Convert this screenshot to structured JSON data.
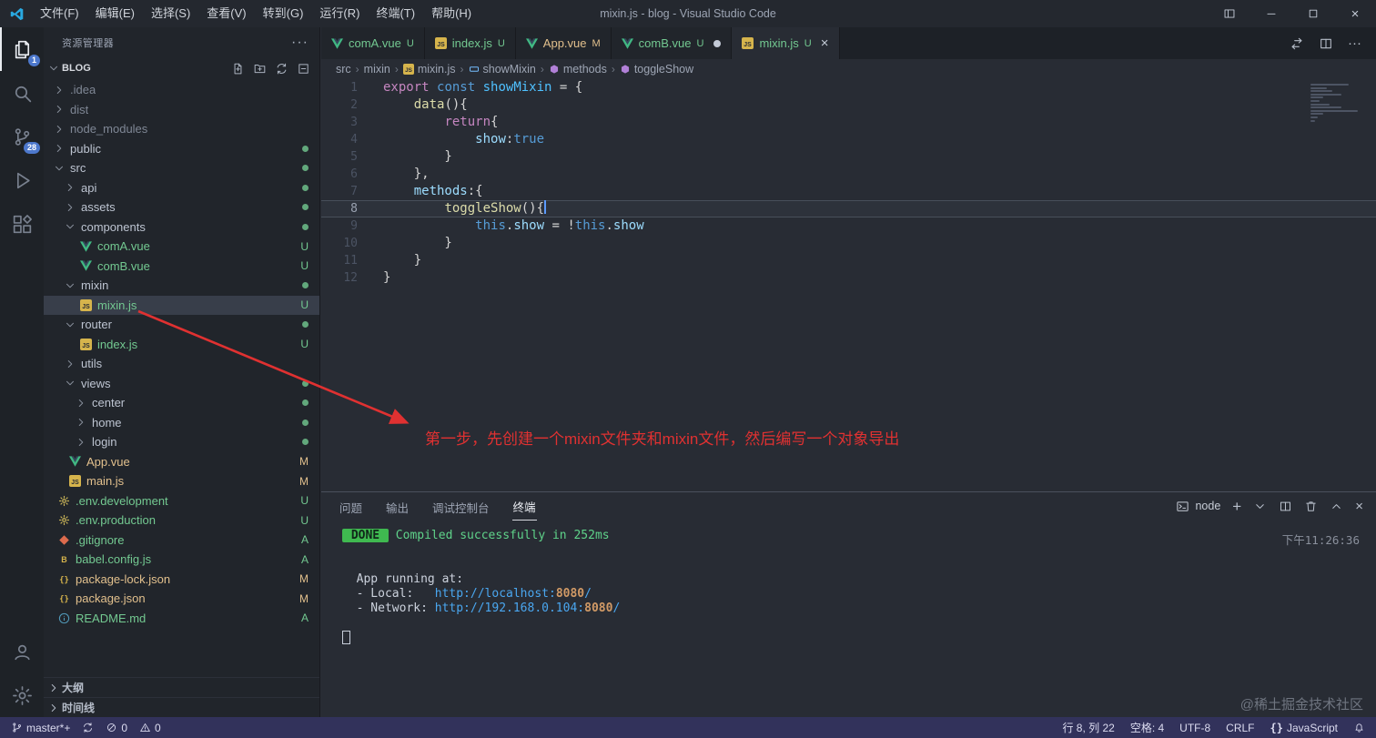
{
  "titlebar": {
    "menus": [
      "文件(F)",
      "编辑(E)",
      "选择(S)",
      "查看(V)",
      "转到(G)",
      "运行(R)",
      "终端(T)",
      "帮助(H)"
    ],
    "title": "mixin.js - blog - Visual Studio Code",
    "controls": [
      "layout-icon",
      "minimize-icon",
      "maximize-icon",
      "close-icon"
    ]
  },
  "activity_bar": {
    "items": [
      {
        "name": "explorer",
        "icon": "files-icon",
        "badge": "1",
        "active": true
      },
      {
        "name": "search",
        "icon": "search-icon"
      },
      {
        "name": "source-control",
        "icon": "source-control-icon",
        "badge": "28"
      },
      {
        "name": "run-debug",
        "icon": "debug-icon"
      },
      {
        "name": "extensions",
        "icon": "extensions-icon"
      }
    ],
    "bottom": [
      {
        "name": "accounts",
        "icon": "account-icon"
      },
      {
        "name": "settings",
        "icon": "gear-icon"
      }
    ]
  },
  "sidebar": {
    "header": "资源管理器",
    "project": "BLOG",
    "actions": [
      "new-file-icon",
      "new-folder-icon",
      "refresh-icon",
      "collapse-icon"
    ],
    "tree": [
      {
        "label": ".idea",
        "depth": 0,
        "type": "folder",
        "expanded": false,
        "ignored": true
      },
      {
        "label": "dist",
        "depth": 0,
        "type": "folder",
        "expanded": false,
        "ignored": true
      },
      {
        "label": "node_modules",
        "depth": 0,
        "type": "folder",
        "expanded": false,
        "ignored": true
      },
      {
        "label": "public",
        "depth": 0,
        "type": "folder",
        "expanded": false,
        "dot": true
      },
      {
        "label": "src",
        "depth": 0,
        "type": "folder",
        "expanded": true,
        "dot": true
      },
      {
        "label": "api",
        "depth": 1,
        "type": "folder",
        "expanded": false,
        "dot": true
      },
      {
        "label": "assets",
        "depth": 1,
        "type": "folder",
        "expanded": false,
        "dot": true
      },
      {
        "label": "components",
        "depth": 1,
        "type": "folder",
        "expanded": true,
        "dot": true
      },
      {
        "label": "comA.vue",
        "depth": 2,
        "type": "file",
        "icon": "vue",
        "badge": "U"
      },
      {
        "label": "comB.vue",
        "depth": 2,
        "type": "file",
        "icon": "vue",
        "badge": "U"
      },
      {
        "label": "mixin",
        "depth": 1,
        "type": "folder",
        "expanded": true,
        "dot": true
      },
      {
        "label": "mixin.js",
        "depth": 2,
        "type": "file",
        "icon": "js",
        "badge": "U",
        "selected": true
      },
      {
        "label": "router",
        "depth": 1,
        "type": "folder",
        "expanded": true,
        "dot": true
      },
      {
        "label": "index.js",
        "depth": 2,
        "type": "file",
        "icon": "js",
        "badge": "U"
      },
      {
        "label": "utils",
        "depth": 1,
        "type": "folder",
        "expanded": false
      },
      {
        "label": "views",
        "depth": 1,
        "type": "folder",
        "expanded": true,
        "dot": true
      },
      {
        "label": "center",
        "depth": 2,
        "type": "folder",
        "expanded": false,
        "dot": true
      },
      {
        "label": "home",
        "depth": 2,
        "type": "folder",
        "expanded": false,
        "dot": true
      },
      {
        "label": "login",
        "depth": 2,
        "type": "folder",
        "expanded": false,
        "dot": true
      },
      {
        "label": "App.vue",
        "depth": 1,
        "type": "file",
        "icon": "vue",
        "badge": "M"
      },
      {
        "label": "main.js",
        "depth": 1,
        "type": "file",
        "icon": "js",
        "badge": "M"
      },
      {
        "label": ".env.development",
        "depth": 0,
        "type": "file",
        "icon": "gear-file",
        "badge": "U"
      },
      {
        "label": ".env.production",
        "depth": 0,
        "type": "file",
        "icon": "gear-file",
        "badge": "U"
      },
      {
        "label": ".gitignore",
        "depth": 0,
        "type": "file",
        "icon": "git",
        "badge": "A"
      },
      {
        "label": "babel.config.js",
        "depth": 0,
        "type": "file",
        "icon": "babel",
        "badge": "A"
      },
      {
        "label": "package-lock.json",
        "depth": 0,
        "type": "file",
        "icon": "json",
        "badge": "M"
      },
      {
        "label": "package.json",
        "depth": 0,
        "type": "file",
        "icon": "json",
        "badge": "M"
      },
      {
        "label": "README.md",
        "depth": 0,
        "type": "file",
        "icon": "info",
        "badge": "A"
      }
    ],
    "sections": [
      "大纲",
      "时间线"
    ]
  },
  "tabs": [
    {
      "label": "comA.vue",
      "icon": "vue",
      "badge": "U"
    },
    {
      "label": "index.js",
      "icon": "js",
      "badge": "U"
    },
    {
      "label": "App.vue",
      "icon": "vue",
      "badge": "M"
    },
    {
      "label": "comB.vue",
      "icon": "vue",
      "badge": "U",
      "dirty": true
    },
    {
      "label": "mixin.js",
      "icon": "js",
      "badge": "U",
      "active": true,
      "close": true
    }
  ],
  "editor": {
    "tab_actions": [
      "open-changes-icon",
      "split-icon",
      "ellipsis-icon"
    ],
    "breadcrumb": [
      {
        "label": "src"
      },
      {
        "label": "mixin"
      },
      {
        "label": "mixin.js",
        "icon": "js-icon"
      },
      {
        "label": "showMixin",
        "icon": "symbol-variable-icon"
      },
      {
        "label": "methods",
        "icon": "symbol-method-icon"
      },
      {
        "label": "toggleShow",
        "icon": "symbol-method-icon"
      }
    ],
    "active_line": 8,
    "lines": [
      {
        "n": 1,
        "tokens": [
          {
            "t": "export",
            "c": "kw2"
          },
          {
            "t": " ",
            "c": "pun"
          },
          {
            "t": "const",
            "c": "kw"
          },
          {
            "t": " ",
            "c": "pun"
          },
          {
            "t": "showMixin",
            "c": "var"
          },
          {
            "t": " = {",
            "c": "pun"
          }
        ]
      },
      {
        "n": 2,
        "tokens": [
          {
            "t": "    ",
            "c": "pun"
          },
          {
            "t": "data",
            "c": "fn"
          },
          {
            "t": "(){",
            "c": "pun"
          }
        ]
      },
      {
        "n": 3,
        "tokens": [
          {
            "t": "        ",
            "c": "pun"
          },
          {
            "t": "return",
            "c": "kw2"
          },
          {
            "t": "{",
            "c": "pun"
          }
        ]
      },
      {
        "n": 4,
        "tokens": [
          {
            "t": "            ",
            "c": "pun"
          },
          {
            "t": "show",
            "c": "prop"
          },
          {
            "t": ":",
            "c": "pun"
          },
          {
            "t": "true",
            "c": "kw"
          }
        ]
      },
      {
        "n": 5,
        "tokens": [
          {
            "t": "        }",
            "c": "pun"
          }
        ]
      },
      {
        "n": 6,
        "tokens": [
          {
            "t": "    },",
            "c": "pun"
          }
        ]
      },
      {
        "n": 7,
        "tokens": [
          {
            "t": "    ",
            "c": "pun"
          },
          {
            "t": "methods",
            "c": "prop"
          },
          {
            "t": ":{",
            "c": "pun"
          }
        ]
      },
      {
        "n": 8,
        "tokens": [
          {
            "t": "        ",
            "c": "pun"
          },
          {
            "t": "toggleShow",
            "c": "fn"
          },
          {
            "t": "(){",
            "c": "pun"
          }
        ]
      },
      {
        "n": 9,
        "tokens": [
          {
            "t": "            ",
            "c": "pun"
          },
          {
            "t": "this",
            "c": "kw"
          },
          {
            "t": ".",
            "c": "pun"
          },
          {
            "t": "show",
            "c": "prop"
          },
          {
            "t": " = ",
            "c": "pun"
          },
          {
            "t": "!",
            "c": "pun"
          },
          {
            "t": "this",
            "c": "kw"
          },
          {
            "t": ".",
            "c": "pun"
          },
          {
            "t": "show",
            "c": "prop"
          }
        ]
      },
      {
        "n": 10,
        "tokens": [
          {
            "t": "        }",
            "c": "pun"
          }
        ]
      },
      {
        "n": 11,
        "tokens": [
          {
            "t": "    }",
            "c": "pun"
          }
        ]
      },
      {
        "n": 12,
        "tokens": [
          {
            "t": "}",
            "c": "pun"
          }
        ]
      }
    ]
  },
  "panel": {
    "tabs": [
      {
        "label": "问题"
      },
      {
        "label": "输出"
      },
      {
        "label": "调试控制台"
      },
      {
        "label": "终端",
        "active": true
      }
    ],
    "terminal_select": "node",
    "actions": [
      {
        "name": "terminal-shell-select",
        "icon": "terminal-icon",
        "label": "node"
      },
      {
        "name": "new-terminal",
        "icon": "plus-icon"
      },
      {
        "name": "terminal-dropdown",
        "icon": "chevron-down-icon"
      },
      {
        "name": "split-terminal",
        "icon": "split-icon"
      },
      {
        "name": "kill-terminal",
        "icon": "trash-icon"
      },
      {
        "name": "maximize-panel",
        "icon": "chevron-up-icon"
      },
      {
        "name": "close-panel",
        "icon": "close-icon"
      }
    ],
    "time": "下午11:26:36",
    "terminal_lines": [
      [
        {
          "t": " DONE ",
          "c": "badge"
        },
        {
          "t": " Compiled successfully in 252ms",
          "c": "green"
        }
      ],
      [],
      [],
      [
        {
          "t": "  App running at:",
          "c": "def"
        }
      ],
      [
        {
          "t": "  - Local:   ",
          "c": "def"
        },
        {
          "t": "http://localhost:",
          "c": "url"
        },
        {
          "t": "8080",
          "c": "port"
        },
        {
          "t": "/",
          "c": "url"
        }
      ],
      [
        {
          "t": "  - Network: ",
          "c": "def"
        },
        {
          "t": "http://192.168.0.104:",
          "c": "url"
        },
        {
          "t": "8080",
          "c": "port"
        },
        {
          "t": "/",
          "c": "url"
        }
      ],
      [],
      [
        {
          "t": "",
          "c": "cursor"
        }
      ]
    ]
  },
  "statusbar": {
    "items_left": [
      {
        "name": "git-branch",
        "icon": "branch-icon",
        "label": "master*+"
      },
      {
        "name": "sync",
        "icon": "sync-icon",
        "label": ""
      },
      {
        "name": "errors",
        "icon": "error-icon",
        "label": "0"
      },
      {
        "name": "warnings",
        "icon": "warning-icon",
        "label": "0"
      }
    ],
    "items_right": [
      {
        "name": "cursor-position",
        "label": "行 8, 列 22"
      },
      {
        "name": "indentation",
        "label": "空格: 4"
      },
      {
        "name": "encoding",
        "label": "UTF-8"
      },
      {
        "name": "eol",
        "label": "CRLF"
      },
      {
        "name": "language-mode",
        "icon": "braces",
        "label": "JavaScript"
      },
      {
        "name": "notifications",
        "icon": "bell-icon",
        "label": ""
      }
    ]
  },
  "annotation": {
    "text": "第一步，先创建一个mixin文件夹和mixin文件，然后编写一个对象导出"
  },
  "watermark": {
    "text": "@稀土掘金技术社区"
  },
  "colors": {
    "git_untracked": "#73c991",
    "git_modified": "#e2c08d",
    "badge_blue": "#4d78cc",
    "annotation_red": "#e03131",
    "done_badge_green": "#3fb950"
  }
}
